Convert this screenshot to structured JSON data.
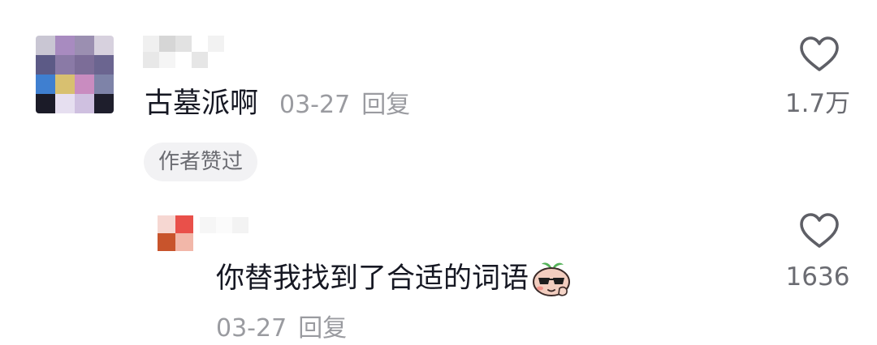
{
  "comment": {
    "text": "古墓派啊",
    "date": "03-27",
    "reply_label": "回复",
    "badge": "作者赞过",
    "like_count": "1.7万",
    "like_icon": "heart-outline-icon"
  },
  "reply": {
    "text": "你替我找到了合适的词语",
    "sticker_icon": "cool-sunglasses-emoji-icon",
    "date": "03-27",
    "reply_label": "回复",
    "like_count": "1636",
    "like_icon": "heart-outline-icon"
  },
  "colors": {
    "text_primary": "#161823",
    "text_secondary": "#9a9ba0",
    "like_count": "#6b6c72",
    "badge_bg": "#f2f2f4"
  }
}
